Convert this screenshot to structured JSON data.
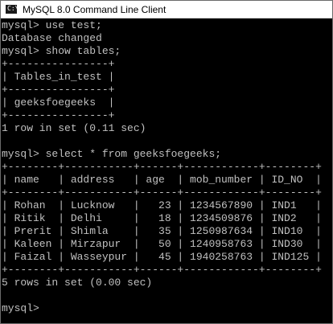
{
  "window": {
    "title": "MySQL 8.0 Command Line Client",
    "icon": "console-icon",
    "icon_glyph": "C:\\_"
  },
  "colors": {
    "console_bg": "#000000",
    "console_text": "#c0c0c0",
    "titlebar_bg": "#ffffff"
  },
  "console": {
    "lines": [
      "mysql> use test;",
      "Database changed",
      "mysql> show tables;",
      "+----------------+",
      "| Tables_in_test |",
      "+----------------+",
      "| geeksfoegeeks  |",
      "+----------------+",
      "1 row in set (0.11 sec)",
      "",
      "mysql> select * from geeksfoegeeks;",
      "+--------+-----------+------+------------+--------+",
      "| name   | address   | age  | mob_number | ID_NO  |",
      "+--------+-----------+------+------------+--------+",
      "| Rohan  | Lucknow   |   23 | 1234567890 | IND1   |",
      "| Ritik  | Delhi     |   18 | 1234509876 | IND2   |",
      "| Prerit | Shimla    |   35 | 1250987634 | IND10  |",
      "| Kaleen | Mirzapur  |   50 | 1240958763 | IND30  |",
      "| Faizal | Wasseypur |   45 | 1940258763 | IND125 |",
      "+--------+-----------+------+------------+--------+",
      "5 rows in set (0.00 sec)",
      "",
      "mysql>"
    ]
  }
}
